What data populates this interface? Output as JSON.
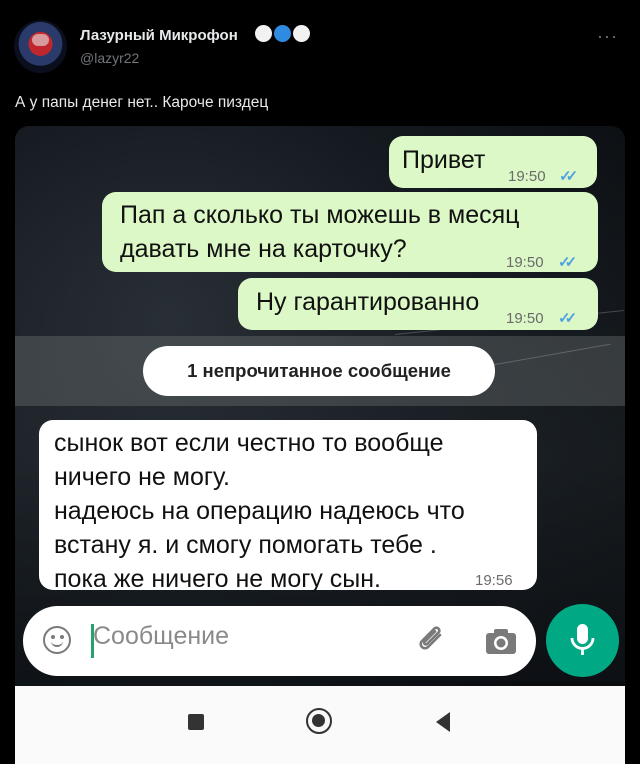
{
  "tweet": {
    "author_name": "Лазурный Микрофон",
    "author_emojis": [
      "white-heart",
      "blue-heart",
      "white-heart"
    ],
    "handle": "@lazyr22",
    "more": "···",
    "text": "А у папы денег нет.. Кароче пиздец"
  },
  "chat": {
    "messages": [
      {
        "direction": "outgoing",
        "lines": [
          "Привет"
        ],
        "time": "19:50",
        "status": "read"
      },
      {
        "direction": "outgoing",
        "lines": [
          "Пап а сколько ты можешь в месяц",
          "давать мне на карточку?"
        ],
        "time": "19:50",
        "status": "read"
      },
      {
        "direction": "outgoing",
        "lines": [
          "Ну гарантированно"
        ],
        "time": "19:50",
        "status": "read"
      },
      {
        "direction": "incoming",
        "lines": [
          "сынок вот если честно то вообще",
          "ничего не могу.",
          "надеюсь на операцию надеюсь что",
          "встану я. и смогу помогать тебе .",
          "пока же ничего не могу сын."
        ],
        "time": "19:56"
      }
    ],
    "unread_label": "1 непрочитанное сообщение",
    "input_placeholder": "Сообщение",
    "read_ticks": "✓✓"
  },
  "colors": {
    "outgoing_bubble": "#dcf8c6",
    "incoming_bubble": "#ffffff",
    "mic_button": "#00a884",
    "ticks": "#4fa3e0"
  },
  "icons": [
    "emoji-icon",
    "attach-paperclip-icon",
    "camera-icon",
    "microphone-icon",
    "nav-recents-icon",
    "nav-home-icon",
    "nav-back-icon"
  ]
}
